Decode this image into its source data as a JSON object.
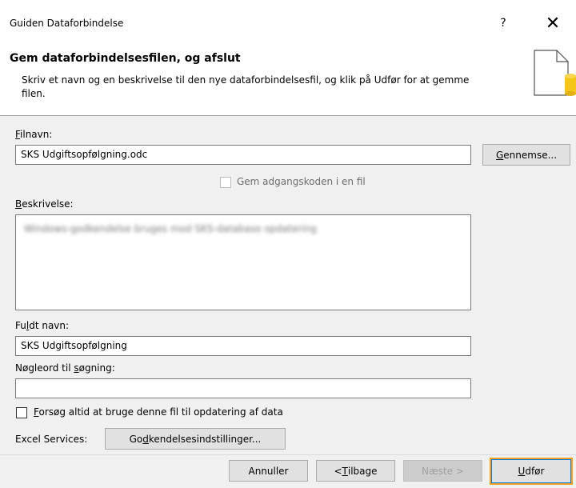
{
  "window": {
    "title": "Guiden Dataforbindelse",
    "help_glyph": "?",
    "close_glyph": "✕"
  },
  "header": {
    "title": "Gem dataforbindelsesfilen, og afslut",
    "description": "Skriv et navn og en beskrivelse til den nye dataforbindelsesfil, og klik på Udfør for at gemme filen.",
    "icon": "document-database-icon",
    "icon_accent": "#f5c518"
  },
  "filename": {
    "label_first": "F",
    "label_rest": "ilnavn:",
    "value": "SKS Udgiftsopfølgning.odc",
    "browse_first": "G",
    "browse_rest": "ennemse..."
  },
  "save_password": {
    "label": "Gem adgangskoden i en fil",
    "checked": false,
    "enabled": false
  },
  "description": {
    "label_first": "B",
    "label_rest": "eskrivelse:",
    "value_blurred": "Windows-godkendelse bruges mod SKS-database opdatering"
  },
  "full_name": {
    "label_pre": "Fu",
    "label_u": "l",
    "label_post": "dt navn:",
    "value": "SKS Udgiftsopfølgning"
  },
  "keywords": {
    "label_pre": "Nøgleord til ",
    "label_u": "s",
    "label_post": "øgning:",
    "value": ""
  },
  "always_use": {
    "label_u": "F",
    "label_rest": "orsøg altid at bruge denne fil til opdatering af data",
    "checked": false
  },
  "excel_services": {
    "label": "Excel Services:",
    "button_pre": "Go",
    "button_u": "d",
    "button_post": "kendelsesindstillinger..."
  },
  "buttons": {
    "cancel": "Annuller",
    "back_pre": "< ",
    "back_u": "T",
    "back_post": "ilbage",
    "next": "Næste >",
    "finish_u": "U",
    "finish_rest": "dfør"
  },
  "colors": {
    "focus_highlight": "#f0a326",
    "default_button_border": "#0078d7"
  }
}
